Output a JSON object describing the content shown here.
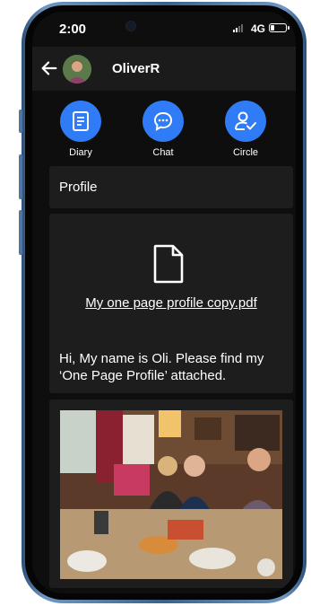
{
  "status_bar": {
    "time": "2:00",
    "network": "4G"
  },
  "app_bar": {
    "username": "OliverR"
  },
  "actions": [
    {
      "label": "Diary",
      "icon": "diary-icon"
    },
    {
      "label": "Chat",
      "icon": "chat-bubble-icon"
    },
    {
      "label": "Circle",
      "icon": "person-check-icon"
    }
  ],
  "profile_section": {
    "title": "Profile"
  },
  "post": {
    "attachment_name": "My one page profile copy.pdf",
    "attachment_icon": "document-icon",
    "message": "Hi, My name is Oli. Please find my ‘One Page Profile’ attached."
  },
  "colors": {
    "accent": "#2f7cf6",
    "background": "#0e0e0e",
    "card": "#1d1d1d"
  }
}
